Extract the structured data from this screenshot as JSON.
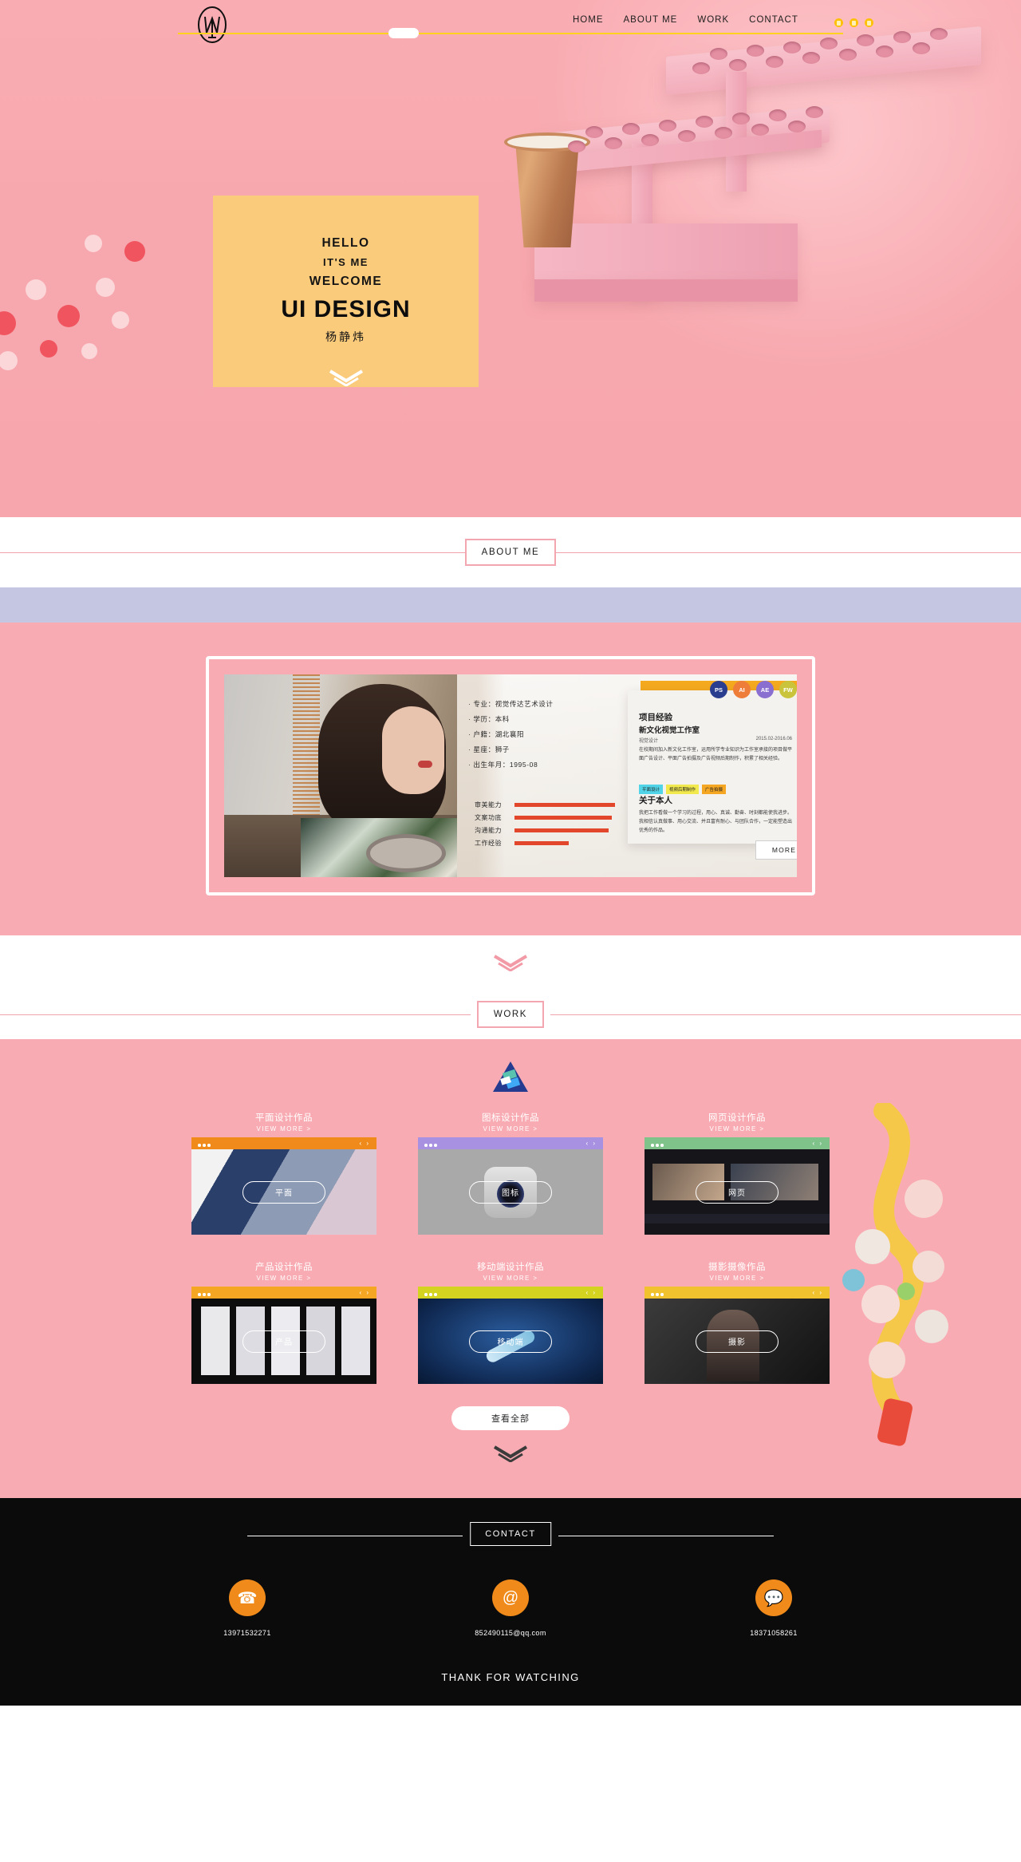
{
  "nav": {
    "logo_alt": "monogram-logo",
    "links": [
      "HOME",
      "ABOUT ME",
      "WORK",
      "CONTACT"
    ],
    "active": "HOME"
  },
  "hero": {
    "line1": "HELLO",
    "line2": "IT'S ME",
    "line3": "WELCOME",
    "title": "UI DESIGN",
    "name": "杨静炜",
    "scroll_hint": "chevron-down"
  },
  "sections": {
    "about_tag": "ABOUT ME",
    "work_tag": "WORK",
    "contact_tag": "CONTACT"
  },
  "about": {
    "bio": [
      "专业：视觉传达艺术设计",
      "学历：本科",
      "户籍：湖北襄阳",
      "星座：狮子",
      "出生年月：1995-08"
    ],
    "skills": [
      {
        "name": "审美能力",
        "pct": 96
      },
      {
        "name": "文案功底",
        "pct": 93
      },
      {
        "name": "沟通能力",
        "pct": 90
      },
      {
        "name": "工作经验",
        "pct": 52
      }
    ],
    "tools": [
      {
        "label": "PS",
        "color": "#2b3d8f"
      },
      {
        "label": "AI",
        "color": "#ef7d3a"
      },
      {
        "label": "AE",
        "color": "#8b6fd0"
      },
      {
        "label": "FW",
        "color": "#c9c43c"
      }
    ],
    "project_title": "项目经验",
    "project_company": "新文化视觉工作室",
    "project_role": "视觉设计",
    "project_date": "2015.02-2016.06",
    "project_text": "在校期间加入新文化工作室，运用所学专业知识为工作室承接的项目做平面广告设计、平面广告拍摄及广告视频后期制作，积累了相关经验。",
    "tags": [
      {
        "label": "平面设计",
        "color": "#52d4e8"
      },
      {
        "label": "视频后期制作",
        "color": "#f2e94e"
      },
      {
        "label": "广告拍摄",
        "color": "#f5a623"
      }
    ],
    "about_title": "关于本人",
    "about_text": "我把工作看做一个学习的过程，用心、真诚、勤奋、时刻都能使我进步。我相信认真做事、用心交流、并且富有耐心、与团队合作，一定能塑造出优秀的作品。",
    "more_label": "MORE"
  },
  "work": {
    "view_more": "VIEW MORE >",
    "items": [
      {
        "title": "平面设计作品",
        "pill": "平面",
        "bar": "#f08a1a",
        "shot": "poster"
      },
      {
        "title": "图标设计作品",
        "pill": "图标",
        "bar": "#a791e0",
        "shot": "icon"
      },
      {
        "title": "网页设计作品",
        "pill": "网页",
        "bar": "#7fc38a",
        "shot": "web"
      },
      {
        "title": "产品设计作品",
        "pill": "产品",
        "bar": "#f5a623",
        "shot": "product"
      },
      {
        "title": "移动端设计作品",
        "pill": "移动端",
        "bar": "#d4d420",
        "shot": "mobile"
      },
      {
        "title": "摄影摄像作品",
        "pill": "摄影",
        "bar": "#f2c12e",
        "shot": "photo"
      }
    ],
    "view_all": "查看全部"
  },
  "footer": {
    "contacts": [
      {
        "icon": "phone-icon",
        "value": "13971532271"
      },
      {
        "icon": "email-icon",
        "value": "852490115@qq.com"
      },
      {
        "icon": "wechat-icon",
        "value": "18371058261"
      }
    ],
    "thanks": "THANK FOR WATCHING"
  }
}
